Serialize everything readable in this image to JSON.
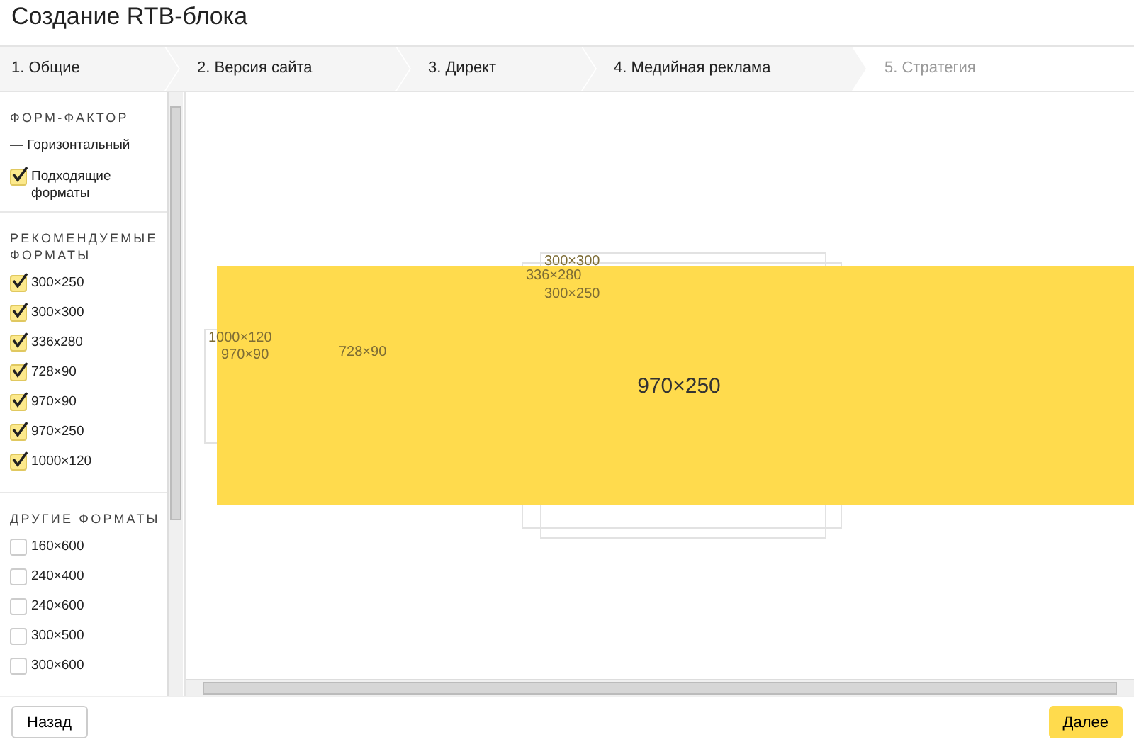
{
  "window": {
    "title": "Создание RTB-блока"
  },
  "steps": [
    {
      "label": "1. Общие",
      "disabled": false
    },
    {
      "label": "2. Версия сайта",
      "disabled": false
    },
    {
      "label": "3. Директ",
      "disabled": false
    },
    {
      "label": "4. Медийная реклама",
      "disabled": false
    },
    {
      "label": "5. Стратегия",
      "disabled": true
    }
  ],
  "sidebar": {
    "sections": [
      {
        "title": "ФОРМ-ФАКТОР",
        "items": [
          {
            "kind": "text",
            "label": "— Горизонтальный"
          },
          {
            "kind": "checkbox",
            "label": "Подходящие форматы",
            "checked": true
          }
        ]
      },
      {
        "title": "РЕКОМЕНДУЕМЫЕ ФОРМАТЫ",
        "items": [
          {
            "kind": "checkbox",
            "label": "300×250",
            "checked": true
          },
          {
            "kind": "checkbox",
            "label": "300×300",
            "checked": true
          },
          {
            "kind": "checkbox",
            "label": "336x280",
            "checked": true
          },
          {
            "kind": "checkbox",
            "label": "728×90",
            "checked": true
          },
          {
            "kind": "checkbox",
            "label": "970×90",
            "checked": true
          },
          {
            "kind": "checkbox",
            "label": "970×250",
            "checked": true
          },
          {
            "kind": "checkbox",
            "label": "1000×120",
            "checked": true
          }
        ]
      },
      {
        "title": "ДРУГИЕ ФОРМАТЫ",
        "items": [
          {
            "kind": "checkbox",
            "label": "160×600",
            "checked": false
          },
          {
            "kind": "checkbox",
            "label": "240×400",
            "checked": false
          },
          {
            "kind": "checkbox",
            "label": "240×600",
            "checked": false
          },
          {
            "kind": "checkbox",
            "label": "300×500",
            "checked": false
          },
          {
            "kind": "checkbox",
            "label": "300×600",
            "checked": false
          }
        ]
      }
    ]
  },
  "preview": {
    "frames": [
      {
        "label": "1000×120",
        "kind": "outline"
      },
      {
        "label": "970×90",
        "kind": "outline"
      },
      {
        "label": "728×90",
        "kind": "outline"
      },
      {
        "label": "300×300",
        "kind": "outline"
      },
      {
        "label": "336×280",
        "kind": "outline"
      },
      {
        "label": "300×250",
        "kind": "outline"
      },
      {
        "label": "970×250",
        "kind": "filled"
      }
    ]
  },
  "buttons": {
    "back": "Назад",
    "next": "Далее"
  }
}
